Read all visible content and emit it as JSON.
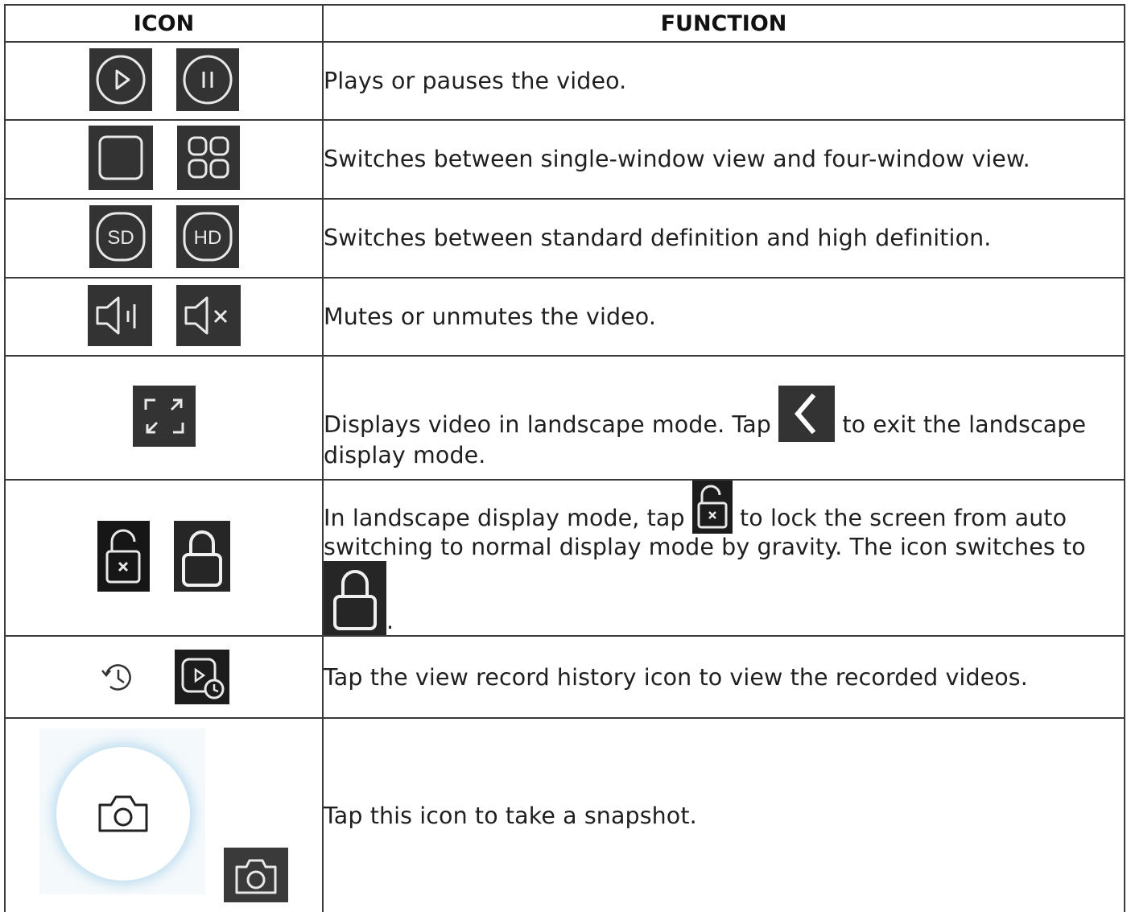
{
  "table": {
    "header": {
      "icon": "ICON",
      "function": "FUNCTION"
    },
    "rows": [
      {
        "icons": [
          "play-circle-icon",
          "pause-circle-icon"
        ],
        "text": "Plays or pauses the video."
      },
      {
        "icons": [
          "single-window-icon",
          "four-window-icon"
        ],
        "text": "Switches between single-window view and four-window view."
      },
      {
        "icons": [
          "sd-icon",
          "hd-icon"
        ],
        "text": "Switches between standard definition and high definition."
      },
      {
        "icons": [
          "speaker-icon",
          "speaker-muted-icon"
        ],
        "text": "Mutes or unmutes the video."
      },
      {
        "icons": [
          "fullscreen-icon"
        ],
        "text_before": "Displays video in landscape mode. Tap",
        "inline_icon": "back-chevron-icon",
        "text_after": " to exit the landscape display mode."
      },
      {
        "icons": [
          "unlock-icon",
          "lock-icon"
        ],
        "text_before": "In landscape display mode, tap",
        "inline_icon": "unlock-icon",
        "text_middle": " to lock the screen from auto switching to normal display mode by gravity. The icon switches to ",
        "inline_icon_2": "lock-icon",
        "text_after": "."
      },
      {
        "icons": [
          "history-icon",
          "record-history-icon"
        ],
        "text": "Tap the view record history icon to view the recorded videos."
      },
      {
        "icons": [
          "snapshot-button-icon",
          "camera-icon"
        ],
        "text": "Tap this icon to take a snapshot."
      }
    ]
  },
  "colors": {
    "icon_bg": "#333333",
    "icon_stroke": "#e8e8e8",
    "border": "#3a3a3a"
  }
}
